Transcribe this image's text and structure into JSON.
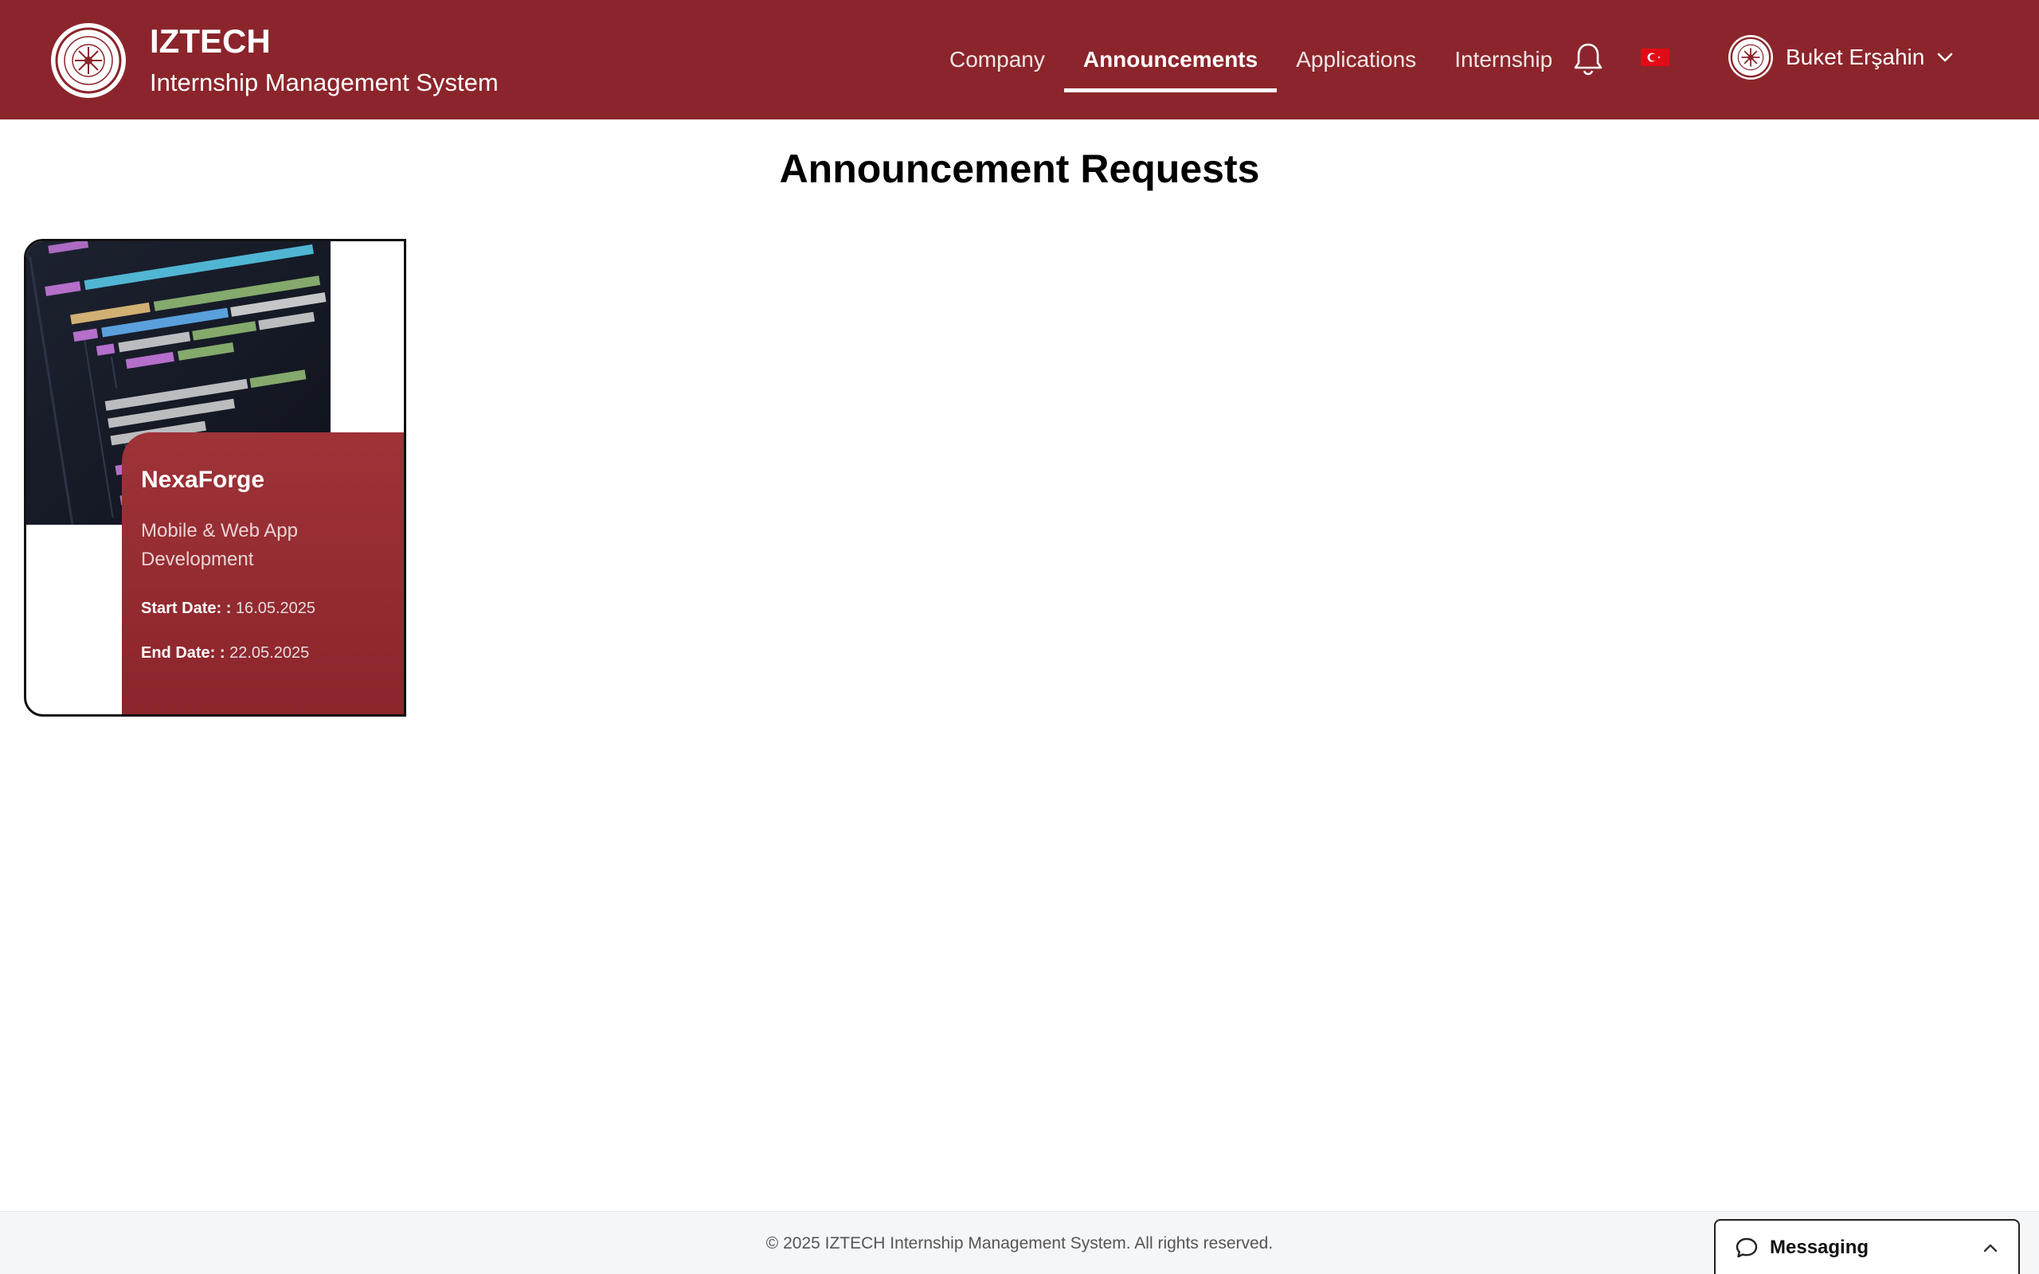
{
  "header": {
    "logo_icon": "university-seal-icon",
    "title": "IZTECH",
    "subtitle": "Internship Management System",
    "nav": [
      {
        "label": "Company",
        "active": false
      },
      {
        "label": "Announcements",
        "active": true
      },
      {
        "label": "Applications",
        "active": false
      },
      {
        "label": "Internship",
        "active": false
      }
    ],
    "notification_icon": "bell-icon",
    "language_icon": "turkish-flag-icon",
    "user": {
      "name": "Buket Erşahin",
      "avatar_icon": "university-seal-icon",
      "menu_icon": "chevron-down-icon"
    }
  },
  "main": {
    "title": "Announcement Requests",
    "cards": [
      {
        "image_icon": "code-screenshot-image",
        "company": "NexaForge",
        "field": "Mobile & Web App Development",
        "start_label": "Start Date: :",
        "start_date": "16.05.2025",
        "end_label": "End Date: :",
        "end_date": "22.05.2025"
      }
    ]
  },
  "footer": {
    "copyright": "© 2025 IZTECH Internship Management System. All rights reserved."
  },
  "messaging": {
    "label": "Messaging",
    "icon": "chat-bubble-icon",
    "toggle_icon": "chevron-up-icon"
  },
  "colors": {
    "brand": "#8b252b",
    "brand_light": "#9e3338",
    "footer_bg": "#f5f6f8",
    "flag_red": "#e30a17"
  }
}
